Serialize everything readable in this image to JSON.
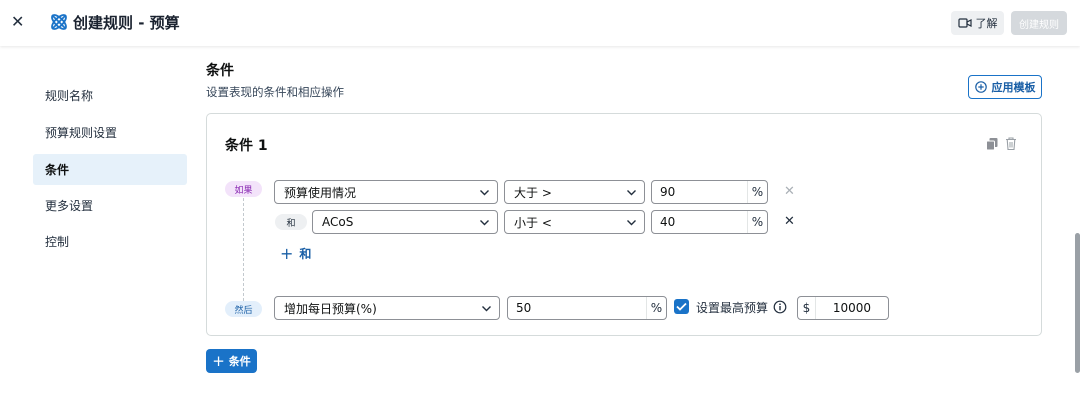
{
  "header": {
    "title": "创建规则 - 预算",
    "learn_label": "了解",
    "create_label": "创建规则",
    "close_icon": "close-icon",
    "logo_icon": "rule-logo-icon",
    "video_icon": "video-icon"
  },
  "sidebar": {
    "items": [
      {
        "label": "规则名称",
        "active": false
      },
      {
        "label": "预算规则设置",
        "active": false
      },
      {
        "label": "条件",
        "active": true
      },
      {
        "label": "更多设置",
        "active": false
      },
      {
        "label": "控制",
        "active": false
      }
    ]
  },
  "section": {
    "title": "条件",
    "subtitle": "设置表现的条件和相应操作",
    "template_label": "应用模板"
  },
  "condition": {
    "title": "条件 1",
    "if_label": "如果",
    "and_label": "和",
    "then_label": "然后",
    "rows": [
      {
        "metric": "预算使用情况",
        "operator": "大于 >",
        "value": "90",
        "unit": "%"
      },
      {
        "metric": "ACoS",
        "operator": "小于 <",
        "value": "40",
        "unit": "%"
      }
    ],
    "add_and_label": "和",
    "action": {
      "metric": "增加每日预算(%)",
      "value": "50",
      "unit": "%",
      "max_budget_checked": true,
      "max_budget_label": "设置最高预算",
      "currency": "$",
      "max_budget_value": "10000"
    }
  },
  "add_condition_label": "条件",
  "colors": {
    "accent": "#1a73c8",
    "active_bg": "#e6f1fa",
    "if_pill": "#f3e3fa",
    "then_pill": "#e3effb"
  }
}
